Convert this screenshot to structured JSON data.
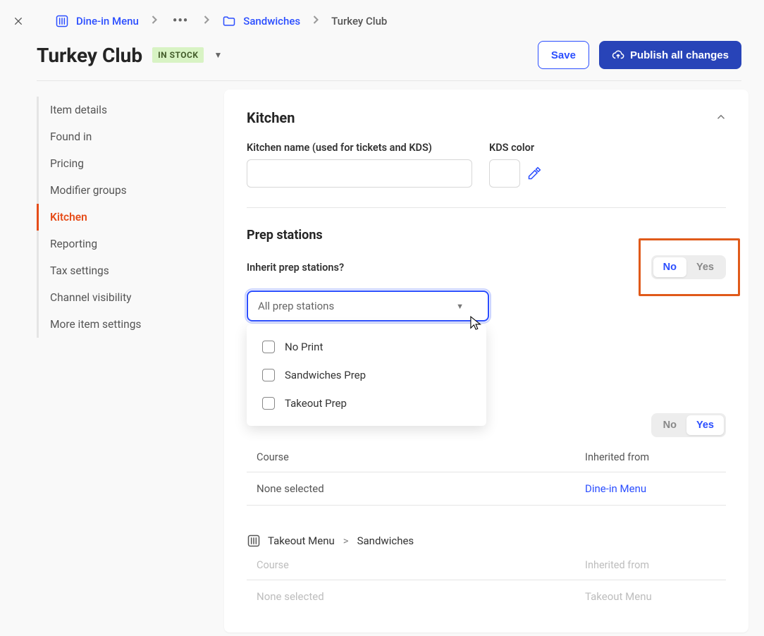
{
  "breadcrumb": {
    "root": "Dine-in Menu",
    "folder": "Sandwiches",
    "current": "Turkey Club"
  },
  "title": "Turkey Club",
  "stock_badge": "IN STOCK",
  "actions": {
    "save": "Save",
    "publish": "Publish all changes"
  },
  "sidenav": {
    "item_details": "Item details",
    "found_in": "Found in",
    "pricing": "Pricing",
    "modifier_groups": "Modifier groups",
    "kitchen": "Kitchen",
    "reporting": "Reporting",
    "tax_settings": "Tax settings",
    "channel_visibility": "Channel visibility",
    "more_item_settings": "More item settings"
  },
  "kitchen": {
    "heading": "Kitchen",
    "name_label": "Kitchen name (used for tickets and KDS)",
    "name_value": "",
    "kds_label": "KDS color"
  },
  "prep": {
    "heading": "Prep stations",
    "inherit_label": "Inherit prep stations?",
    "dropdown_placeholder": "All prep stations",
    "toggle_no": "No",
    "toggle_yes": "Yes",
    "options": {
      "opt0": "No Print",
      "opt1": "Sandwiches Prep",
      "opt2": "Takeout Prep"
    }
  },
  "course": {
    "toggle_no": "No",
    "toggle_yes": "Yes",
    "head_course": "Course",
    "head_inherited": "Inherited from",
    "row1_course": "None selected",
    "row1_inherited": "Dine-in Menu",
    "path_menu": "Takeout Menu",
    "path_cat": "Sandwiches",
    "row2_course": "None selected",
    "row2_inherited": "Takeout Menu"
  }
}
